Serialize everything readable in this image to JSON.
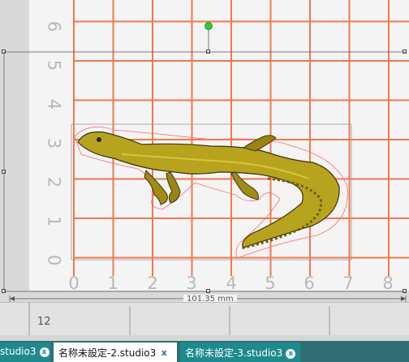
{
  "canvas": {
    "y_axis_labels": [
      "6",
      "5",
      "4",
      "3",
      "2",
      "1",
      "0"
    ],
    "x_axis_labels": [
      "0",
      "1",
      "2",
      "3",
      "4",
      "5",
      "6",
      "7",
      "8"
    ],
    "colors": {
      "grid": "#f07a4a",
      "page": "#f4f4f4",
      "label": "#b8b8b8",
      "rotate_handle": "#33cc33"
    }
  },
  "dimension_label": "101.35 mm",
  "ruler": {
    "value": "12"
  },
  "tabs": [
    {
      "label": "studio3",
      "state": "inactive",
      "close_icon": "close-circle-icon"
    },
    {
      "label": "名称未設定-2.studio3",
      "state": "active",
      "close_icon": "close-x-icon"
    },
    {
      "label": "名称未設定-3.studio3",
      "state": "inactive",
      "close_icon": "close-circle-icon"
    }
  ]
}
